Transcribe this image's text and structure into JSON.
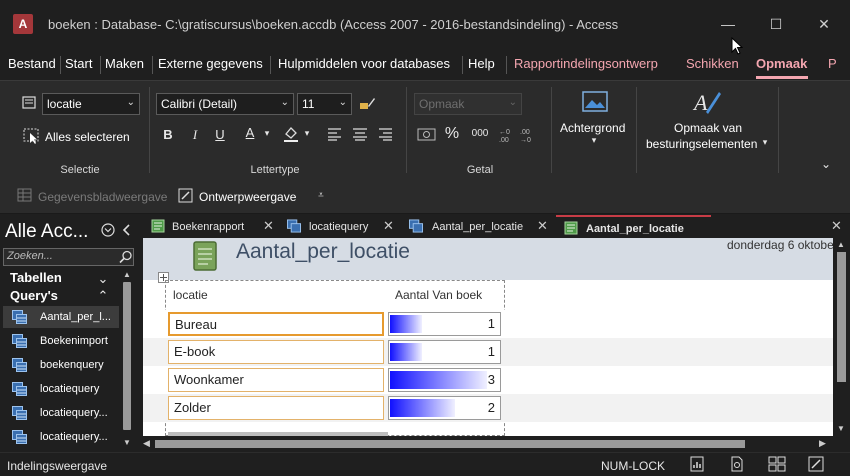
{
  "window": {
    "title": "boeken : Database- C:\\gratiscursus\\boeken.accdb (Access 2007 - 2016-bestandsindeling)  -  Access",
    "app_icon_letter": "A",
    "minimize_glyph": "—",
    "maximize_glyph": "☐",
    "close_glyph": "✕"
  },
  "menu": {
    "items": [
      "Bestand",
      "Start",
      "Maken",
      "Externe gegevens",
      "Hulpmiddelen voor databases",
      "Help"
    ],
    "context_items": [
      "Rapportindelingsontwerp",
      "Schikken"
    ],
    "active_item": "Opmaak",
    "overflow": "P"
  },
  "ribbon": {
    "selectie": {
      "object_combo_value": "locatie",
      "select_all_label": "Alles selecteren",
      "group_label": "Selectie"
    },
    "lettertype": {
      "font_value": "Calibri (Detail)",
      "size_value": "11",
      "bold": "B",
      "italic": "I",
      "underline": "U",
      "font_color_letter": "A",
      "group_label": "Lettertype"
    },
    "getal": {
      "format_placeholder": "Opmaak",
      "percent": "%",
      "comma": "000",
      "group_label": "Getal"
    },
    "achtergrond": {
      "label": "Achtergrond"
    },
    "besturing": {
      "label_line1": "Opmaak van",
      "label_line2": "besturingselementen"
    }
  },
  "quick_toolbar": {
    "datasheet_view": "Gegevensbladweergave",
    "design_view": "Ontwerpweergave"
  },
  "nav_pane": {
    "title": "Alle Acc...",
    "search_placeholder": "Zoeken...",
    "section_tables": "Tabellen",
    "section_queries": "Query's",
    "items": [
      "Aantal_per_l...",
      "Boekenimport",
      "boekenquery",
      "locatiequery",
      "locatiequery...",
      "locatiequery..."
    ]
  },
  "doc_tabs": [
    "Boekenrapport",
    "locatiequery",
    "Aantal_per_locatie",
    "Aantal_per_locatie"
  ],
  "report": {
    "title": "Aantal_per_locatie",
    "date": "donderdag 6 oktober",
    "col_location": "locatie",
    "col_count": "Aantal Van boek",
    "rows": [
      {
        "location": "Bureau",
        "count": "1",
        "count_value": 1
      },
      {
        "location": "E-book",
        "count": "1",
        "count_value": 1
      },
      {
        "location": "Woonkamer",
        "count": "3",
        "count_value": 3
      },
      {
        "location": "Zolder",
        "count": "2",
        "count_value": 2
      }
    ],
    "count_max": 3
  },
  "status": {
    "view_name": "Indelingsweergave",
    "num_lock": "NUM-LOCK"
  },
  "colors": {
    "accent_context": "#f4a6b0",
    "active_tab_border": "#c83c46",
    "bar_start": "#1010ff",
    "header_band": "#d6dce4",
    "title_text": "#3e4f66"
  }
}
